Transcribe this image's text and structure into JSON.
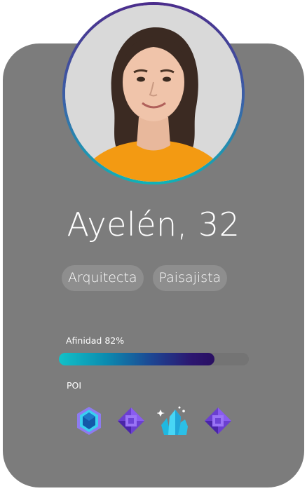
{
  "profile": {
    "name_age": "Ayelén, 32",
    "tags": [
      "Arquitecta",
      "Paisajista"
    ]
  },
  "affinity": {
    "label": "Afinidad 82%",
    "value": 0.82
  },
  "poi": {
    "label": "POI",
    "icons": [
      "blue-hexagon-gem-icon",
      "purple-gem-icon",
      "cyan-crystal-cluster-icon",
      "purple-gem-icon"
    ]
  },
  "colors": {
    "card": "#7c7c7c",
    "accent_start": "#12c2c8",
    "accent_end": "#2a0f62",
    "ring_top": "#4b2d8c",
    "ring_bottom": "#0fb3b8"
  }
}
